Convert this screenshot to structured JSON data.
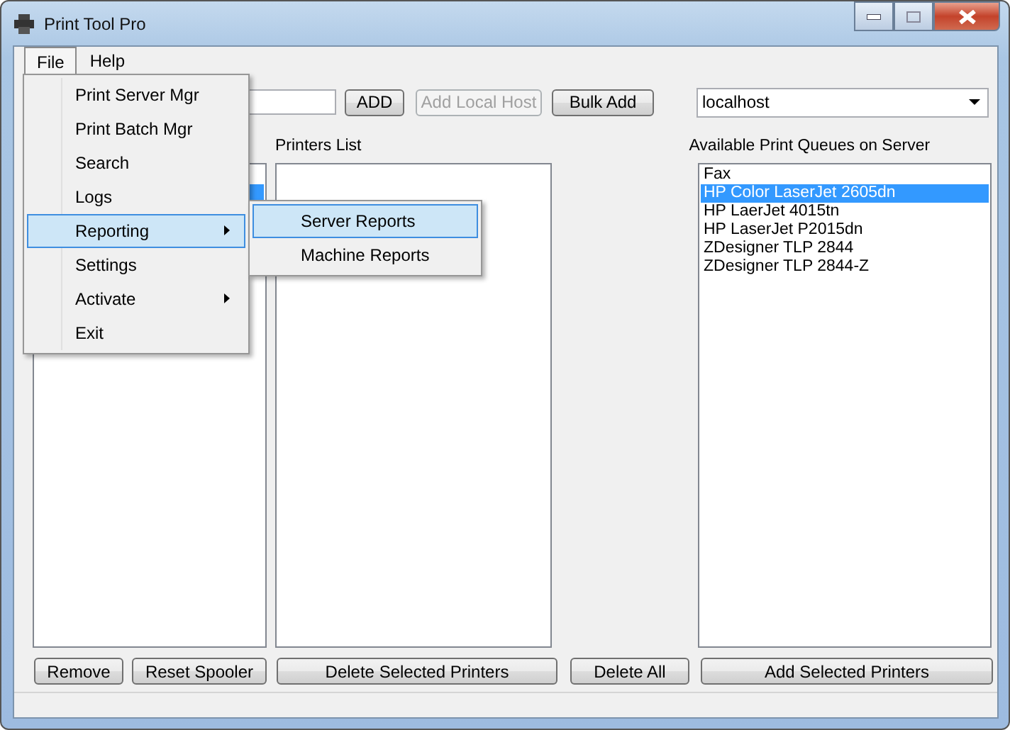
{
  "window": {
    "title": "Print Tool Pro"
  },
  "menu_bar": [
    {
      "label": "File",
      "selected": true
    },
    {
      "label": "Help",
      "selected": false
    }
  ],
  "file_menu": [
    {
      "label": "Print Server Mgr",
      "selected": false,
      "has_submenu": false
    },
    {
      "label": "Print Batch Mgr",
      "selected": false,
      "has_submenu": false
    },
    {
      "label": "Search",
      "selected": false,
      "has_submenu": false
    },
    {
      "label": "Logs",
      "selected": false,
      "has_submenu": false
    },
    {
      "label": "Reporting",
      "selected": true,
      "has_submenu": true
    },
    {
      "label": "Settings",
      "selected": false,
      "has_submenu": false
    },
    {
      "label": "Activate",
      "selected": false,
      "has_submenu": true
    },
    {
      "label": "Exit",
      "selected": false,
      "has_submenu": false
    }
  ],
  "reporting_submenu": [
    {
      "label": "Server Reports",
      "selected": true
    },
    {
      "label": "Machine Reports",
      "selected": false
    }
  ],
  "toolbar": {
    "buttons": [
      {
        "label": "ADD",
        "disabled": false
      },
      {
        "label": "Add Local Host",
        "disabled": true
      },
      {
        "label": "Bulk Add",
        "disabled": false
      }
    ],
    "server_combo": {
      "value": "localhost"
    }
  },
  "machines_list": {
    "items": [
      {
        "selected": false
      },
      {
        "selected": true
      }
    ]
  },
  "printers_list": {
    "label": "Printers List"
  },
  "queues_list": {
    "label": "Available Print Queues on Server",
    "items": [
      {
        "label": "Fax",
        "selected": false
      },
      {
        "label": "HP Color LaserJet 2605dn",
        "selected": true
      },
      {
        "label": "HP LaerJet 4015tn",
        "selected": false
      },
      {
        "label": "HP LaserJet P2015dn",
        "selected": false
      },
      {
        "label": "ZDesigner TLP 2844",
        "selected": false
      },
      {
        "label": "ZDesigner TLP 2844-Z",
        "selected": false
      }
    ]
  },
  "bottom_buttons": [
    "Remove",
    "Reset Spooler",
    "Delete Selected Printers",
    "Delete All",
    "Add Selected Printers"
  ]
}
